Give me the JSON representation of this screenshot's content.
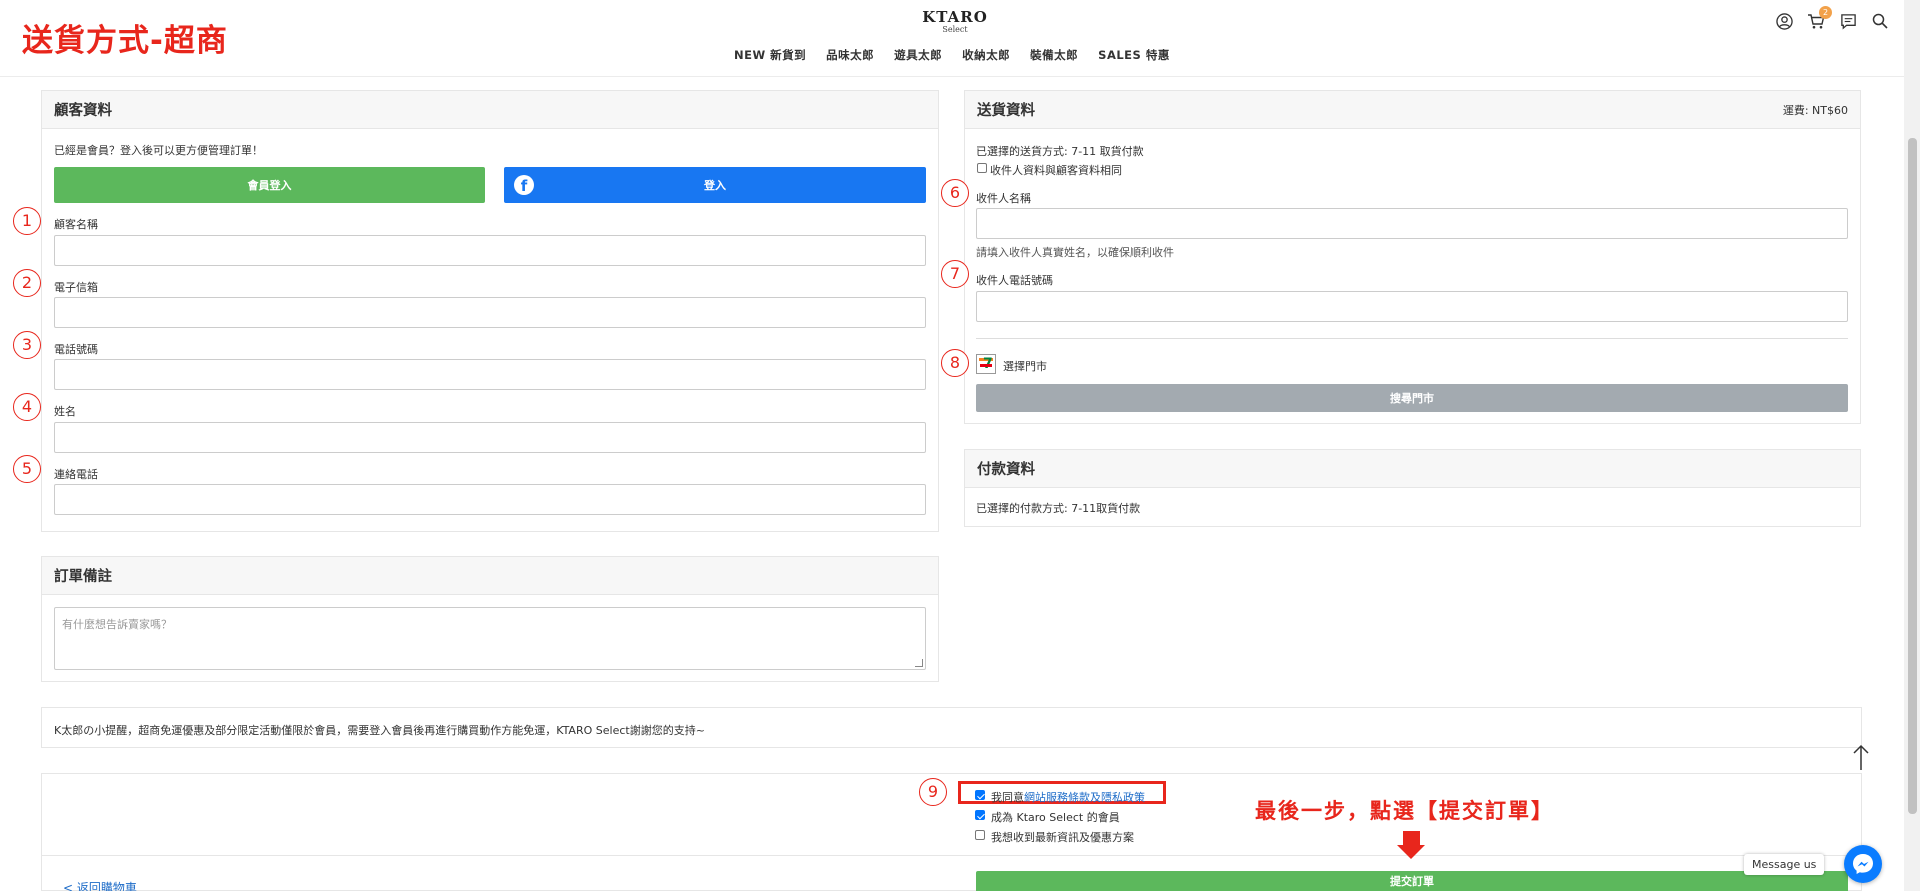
{
  "annotation": {
    "page_title": "送貨方式-超商",
    "numbers": [
      "1",
      "2",
      "3",
      "4",
      "5",
      "6",
      "7",
      "8",
      "9"
    ],
    "last_step": "最後一步，點選【提交訂單】",
    "accent_color": "#e8261c"
  },
  "header": {
    "logo_main": "KTARO",
    "logo_sub": "Select",
    "nav": [
      "NEW 新貨到",
      "品味太郎",
      "遊具太郎",
      "收納太郎",
      "裝備太郎",
      "SALES 特惠"
    ],
    "cart_count": "2",
    "icons": [
      "account-icon",
      "cart-icon",
      "chat-icon",
      "search-icon"
    ]
  },
  "customer": {
    "title": "顧客資料",
    "member_prompt": "已經是會員？登入後可以更方便管理訂單！",
    "member_login_label": "會員登入",
    "fb_login_label": "登入",
    "fields": [
      "顧客名稱",
      "電子信箱",
      "電話號碼",
      "姓名",
      "連絡電話"
    ]
  },
  "delivery": {
    "title": "送貨資料",
    "fee": "運費: NT$60",
    "method": "已選擇的送貨方式: 7-11 取貨付款",
    "same_as_customer": "收件人資料與顧客資料相同",
    "recipient_name_label": "收件人名稱",
    "recipient_name_hint": "請填入收件人真實姓名，以確保順利收件",
    "recipient_phone_label": "收件人電話號碼",
    "store_label": "選擇門市",
    "search_store_label": "搜尋門市"
  },
  "payment": {
    "title": "付款資料",
    "method": "已選擇的付款方式: 7-11取貨付款"
  },
  "notes": {
    "title": "訂單備註",
    "placeholder": "有什麼想告訴賣家嗎？"
  },
  "notice": "K太郎の小提醒，超商免運優惠及部分限定活動僅限於會員，需要登入會員後再進行購買動作方能免運，KTARO Select謝謝您的支持~",
  "terms": {
    "agree_prefix": "我同意",
    "agree_link": "網站服務條款及隱私政策",
    "become_member": "成為 Ktaro Select 的會員",
    "newsletter": "我想收到最新資訊及優惠方案"
  },
  "footer": {
    "back_to_cart": "< 返回購物車",
    "submit_order": "提交訂單"
  },
  "widgets": {
    "message_us": "Message us"
  }
}
